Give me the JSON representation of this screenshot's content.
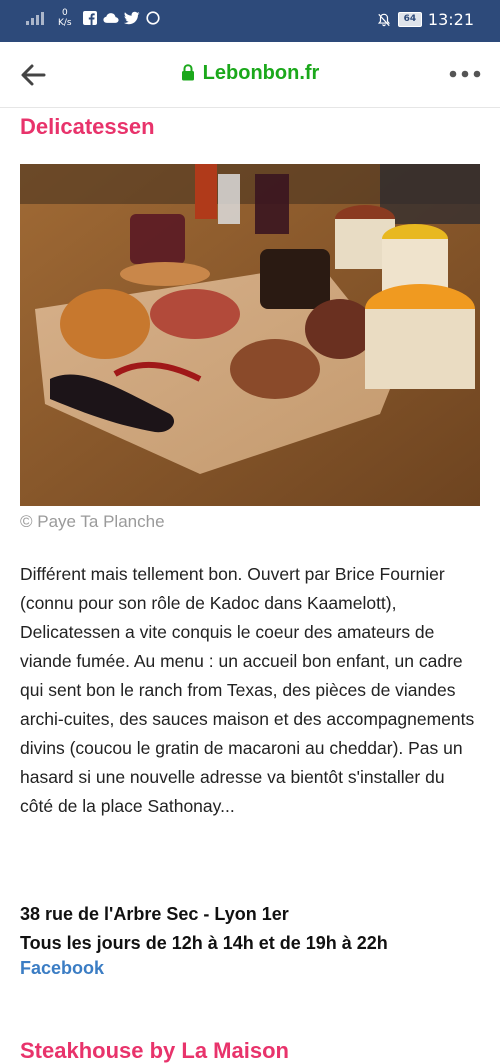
{
  "status_bar": {
    "speed_value": "0",
    "speed_unit": "K/s",
    "battery": "64",
    "time": "13:21"
  },
  "browser": {
    "url": "Lebonbon.fr"
  },
  "article": {
    "section1_title": "Delicatessen",
    "photo_credit": "© Paye Ta Planche",
    "paragraph": "Différent mais tellement bon. Ouvert par Brice Fournier (connu pour son rôle de Kadoc dans Kaamelott), Delicatessen a vite conquis le coeur des amateurs de viande fumée. Au menu : un accueil bon enfant, un cadre qui sent bon le ranch from Texas, des pièces de viandes archi-cuites, des sauces maison et des accompagnements divins (coucou le gratin de macaroni au cheddar). Pas un hasard si une nouvelle adresse va bientôt s'installer du côté de la place Sathonay...",
    "address_line": "38 rue de l'Arbre Sec - Lyon 1er",
    "hours_line": "Tous les jours de 12h à 14h et de 19h à 22h",
    "facebook_label": "Facebook",
    "section2_title": "Steakhouse by La Maison"
  },
  "colors": {
    "status_bar_bg": "#2d4a7a",
    "url_green": "#1ba81b",
    "section_title_pink": "#e8336b",
    "link_blue": "#3b7dc4"
  }
}
